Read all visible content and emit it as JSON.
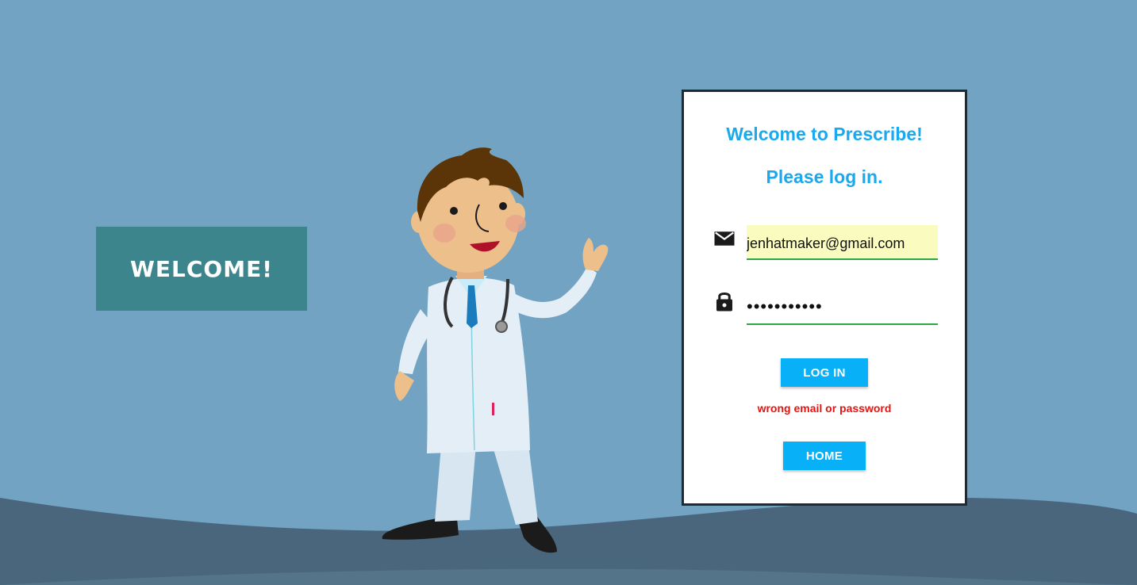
{
  "banner": {
    "text": "WELCOME!"
  },
  "login": {
    "title_line1": "Welcome to Prescribe!",
    "title_line2": "Please log in.",
    "email_icon": "email-icon",
    "lock_icon": "lock-icon",
    "email_value": "jenhatmaker@gmail.com",
    "password_value": "•••••••••••",
    "login_button": "LOG IN",
    "error_message": "wrong email or password",
    "home_button": "HOME"
  },
  "colors": {
    "background": "#72a3c2",
    "ground": "#4a667c",
    "banner": "#3d858d",
    "title": "#1aa9ee",
    "button": "#07b0f7",
    "error": "#e8120e",
    "email_autofill": "#f9fbbf",
    "underline": "#2aa845"
  }
}
